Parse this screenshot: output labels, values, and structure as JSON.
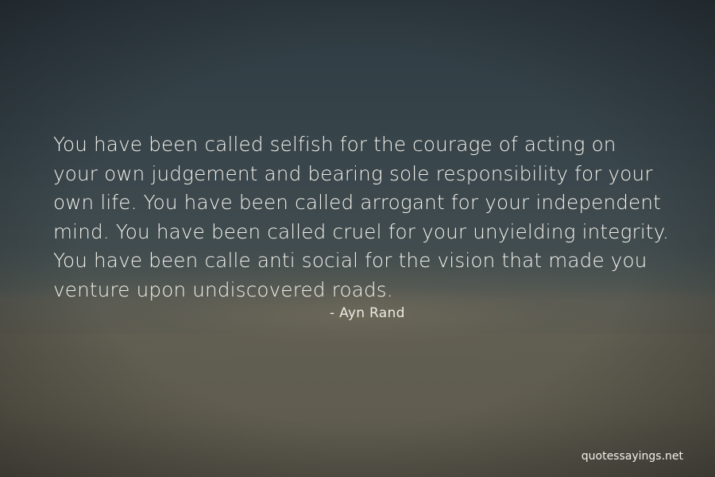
{
  "quote": {
    "lines": [
      "You have been called selfish for the courage of acting on",
      "your own judgement and bearing sole responsibility for your",
      "own life. You have been called arrogant for your independent",
      "mind. You have been called cruel for your unyielding integrity.",
      "You have been calle anti social for the vision that made you",
      "venture upon undiscovered roads."
    ],
    "author": "- Ayn Rand"
  },
  "watermark": "quotessayings.net",
  "colors": {
    "sky": "#2f3b42",
    "horizon": "#5c5b50",
    "text": "#f3f1ea"
  }
}
